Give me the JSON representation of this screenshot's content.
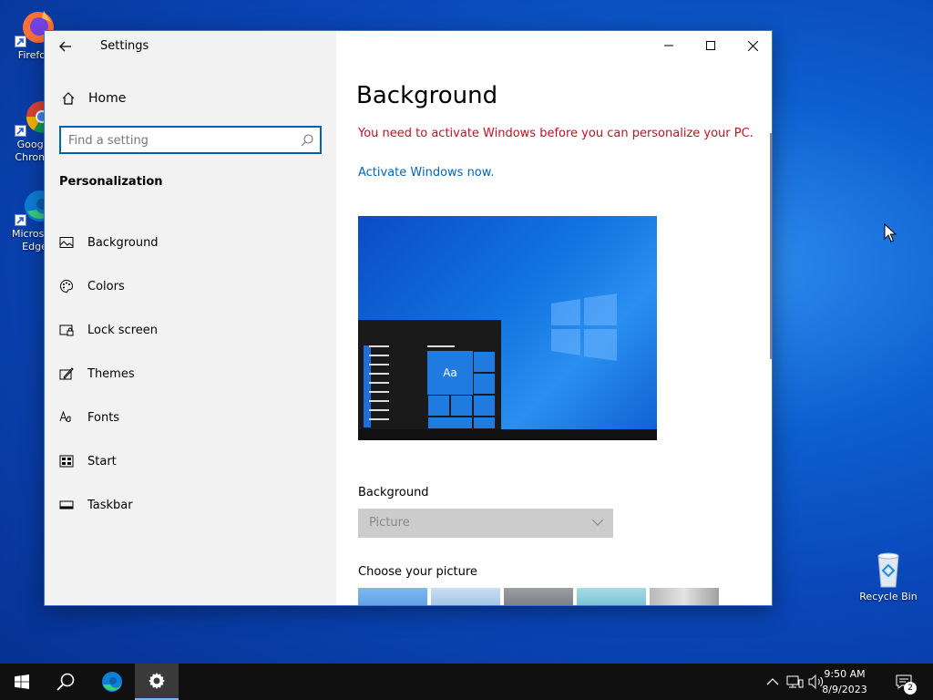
{
  "desktop": {
    "icons": [
      {
        "label": "Firefox"
      },
      {
        "label": "Google Chrome"
      },
      {
        "label": "Microsoft Edge"
      },
      {
        "label": "Recycle Bin"
      }
    ]
  },
  "window": {
    "title": "Settings",
    "controls": {
      "minimize": "—",
      "maximize": "☐",
      "close": "✕"
    }
  },
  "sidebar": {
    "home_label": "Home",
    "search_placeholder": "Find a setting",
    "section_title": "Personalization",
    "items": [
      {
        "label": "Background",
        "icon": "picture-icon"
      },
      {
        "label": "Colors",
        "icon": "palette-icon"
      },
      {
        "label": "Lock screen",
        "icon": "lock-screen-icon"
      },
      {
        "label": "Themes",
        "icon": "themes-icon"
      },
      {
        "label": "Fonts",
        "icon": "fonts-icon"
      },
      {
        "label": "Start",
        "icon": "start-icon"
      },
      {
        "label": "Taskbar",
        "icon": "taskbar-icon"
      }
    ]
  },
  "content": {
    "title": "Background",
    "warning": "You need to activate Windows before you can personalize your PC.",
    "activate_link": "Activate Windows now.",
    "preview_tile_text": "Aa",
    "background_label": "Background",
    "background_value": "Picture",
    "choose_label": "Choose your picture"
  },
  "taskbar": {
    "time": "9:50 AM",
    "date": "8/9/2023",
    "notification_count": "2"
  },
  "colors": {
    "accent": "#0063b1",
    "warning": "#c50f1f",
    "link": "#0067b8"
  }
}
